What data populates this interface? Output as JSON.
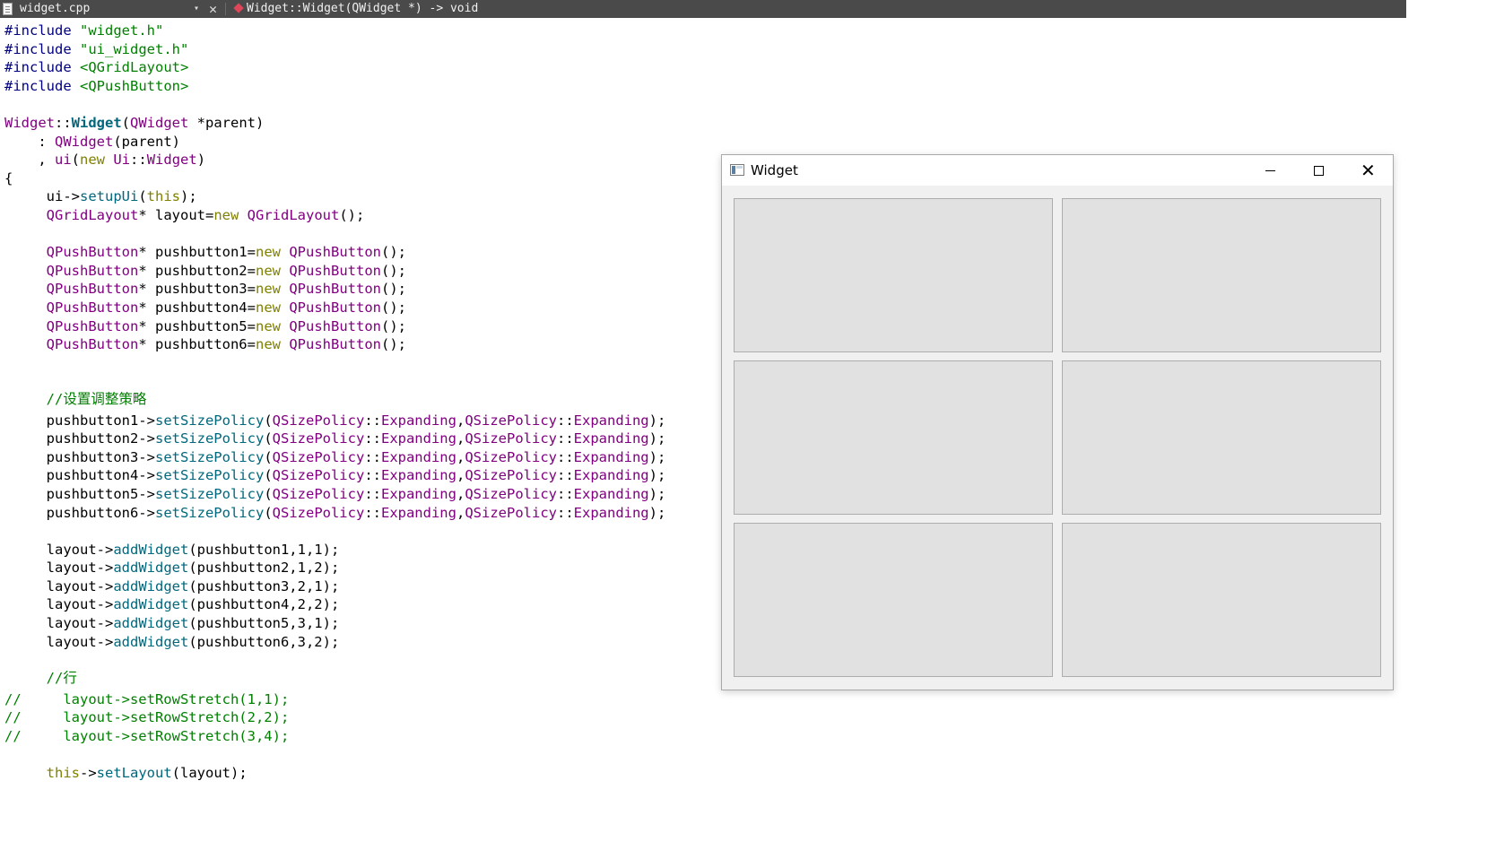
{
  "toolbar": {
    "filename": "widget.cpp",
    "dropdown_glyph": "▾",
    "close_glyph": "✕",
    "current_symbol": "Widget::Widget(QWidget *) -> void"
  },
  "code": {
    "l01": {
      "a": "#include ",
      "b": "\"widget.h\""
    },
    "l02": {
      "a": "#include ",
      "b": "\"ui_widget.h\""
    },
    "l03": {
      "a": "#include ",
      "b": "<QGridLayout>"
    },
    "l04": {
      "a": "#include ",
      "b": "<QPushButton>"
    },
    "l06": {
      "a": "Widget",
      "b": "::",
      "c": "Widget",
      "d": "(",
      "e": "QWidget",
      "f": " *parent)"
    },
    "l07": {
      "a": "    : ",
      "b": "QWidget",
      "c": "(parent)"
    },
    "l08": {
      "a": "    , ",
      "b": "ui",
      "c": "(",
      "d": "new",
      "e": " ",
      "f": "Ui",
      "g": "::",
      "h": "Widget",
      "i": ")"
    },
    "l09": {
      "a": "{"
    },
    "l10": {
      "a": "     ui->",
      "b": "setupUi",
      "c": "(",
      "d": "this",
      "e": ");"
    },
    "l11": {
      "a": "     ",
      "b": "QGridLayout",
      "c": "* layout=",
      "d": "new",
      "e": " ",
      "f": "QGridLayout",
      "g": "();"
    },
    "buttons": [
      {
        "indent": "     ",
        "type": "QPushButton",
        "mid": "* pushbutton1=",
        "kw": "new",
        "sp": " ",
        "ctor": "QPushButton",
        "end": "();"
      },
      {
        "indent": "     ",
        "type": "QPushButton",
        "mid": "* pushbutton2=",
        "kw": "new",
        "sp": " ",
        "ctor": "QPushButton",
        "end": "();"
      },
      {
        "indent": "     ",
        "type": "QPushButton",
        "mid": "* pushbutton3=",
        "kw": "new",
        "sp": " ",
        "ctor": "QPushButton",
        "end": "();"
      },
      {
        "indent": "     ",
        "type": "QPushButton",
        "mid": "* pushbutton4=",
        "kw": "new",
        "sp": " ",
        "ctor": "QPushButton",
        "end": "();"
      },
      {
        "indent": "     ",
        "type": "QPushButton",
        "mid": "* pushbutton5=",
        "kw": "new",
        "sp": " ",
        "ctor": "QPushButton",
        "end": "();"
      },
      {
        "indent": "     ",
        "type": "QPushButton",
        "mid": "* pushbutton6=",
        "kw": "new",
        "sp": " ",
        "ctor": "QPushButton",
        "end": "();"
      }
    ],
    "comment_policy": {
      "indent": "     ",
      "slashes": "//",
      "text": "设置调整策略"
    },
    "policies": [
      {
        "a": "     pushbutton1->",
        "b": "setSizePolicy",
        "c": "(",
        "d": "QSizePolicy",
        "e": "::",
        "f": "Expanding",
        "g": ",",
        "h": "QSizePolicy",
        "i": "::",
        "j": "Expanding",
        "k": ");"
      },
      {
        "a": "     pushbutton2->",
        "b": "setSizePolicy",
        "c": "(",
        "d": "QSizePolicy",
        "e": "::",
        "f": "Expanding",
        "g": ",",
        "h": "QSizePolicy",
        "i": "::",
        "j": "Expanding",
        "k": ");"
      },
      {
        "a": "     pushbutton3->",
        "b": "setSizePolicy",
        "c": "(",
        "d": "QSizePolicy",
        "e": "::",
        "f": "Expanding",
        "g": ",",
        "h": "QSizePolicy",
        "i": "::",
        "j": "Expanding",
        "k": ");"
      },
      {
        "a": "     pushbutton4->",
        "b": "setSizePolicy",
        "c": "(",
        "d": "QSizePolicy",
        "e": "::",
        "f": "Expanding",
        "g": ",",
        "h": "QSizePolicy",
        "i": "::",
        "j": "Expanding",
        "k": ");"
      },
      {
        "a": "     pushbutton5->",
        "b": "setSizePolicy",
        "c": "(",
        "d": "QSizePolicy",
        "e": "::",
        "f": "Expanding",
        "g": ",",
        "h": "QSizePolicy",
        "i": "::",
        "j": "Expanding",
        "k": ");"
      },
      {
        "a": "     pushbutton6->",
        "b": "setSizePolicy",
        "c": "(",
        "d": "QSizePolicy",
        "e": "::",
        "f": "Expanding",
        "g": ",",
        "h": "QSizePolicy",
        "i": "::",
        "j": "Expanding",
        "k": ");"
      }
    ],
    "adds": [
      {
        "a": "     layout->",
        "b": "addWidget",
        "c": "(pushbutton1,1,1);"
      },
      {
        "a": "     layout->",
        "b": "addWidget",
        "c": "(pushbutton2,1,2);"
      },
      {
        "a": "     layout->",
        "b": "addWidget",
        "c": "(pushbutton3,2,1);"
      },
      {
        "a": "     layout->",
        "b": "addWidget",
        "c": "(pushbutton4,2,2);"
      },
      {
        "a": "     layout->",
        "b": "addWidget",
        "c": "(pushbutton5,3,1);"
      },
      {
        "a": "     layout->",
        "b": "addWidget",
        "c": "(pushbutton6,3,2);"
      }
    ],
    "comment_row": {
      "indent": "     ",
      "slashes": "//",
      "text": "行"
    },
    "stretch": [
      "//     layout->setRowStretch(1,1);",
      "//     layout->setRowStretch(2,2);",
      "//     layout->setRowStretch(3,4);"
    ],
    "last": {
      "indent": "     ",
      "a": "this",
      "b": "->",
      "c": "setLayout",
      "d": "(layout);"
    }
  },
  "window": {
    "title": "Widget",
    "close_glyph": "✕",
    "grid": {
      "rows": 3,
      "columns": 2
    }
  },
  "colors": {
    "toolbar_bg": "#4a4a4a",
    "preprocessor": "#000080",
    "string": "#008000",
    "keyword": "#808000",
    "type": "#800080",
    "function": "#00677c",
    "comment": "#008000",
    "button_face": "#e1e1e1",
    "window_bg": "#f0f0f0"
  }
}
